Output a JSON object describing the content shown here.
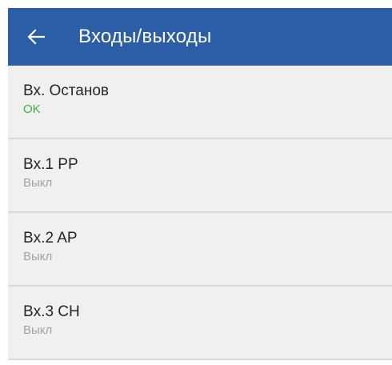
{
  "colors": {
    "appbar": "#2b5ea7",
    "ok": "#3fae49",
    "off": "#9e9e9e"
  },
  "header": {
    "back_icon": "arrow-left-icon",
    "title": "Входы/выходы"
  },
  "items": [
    {
      "label": "Вх. Останов",
      "status": "OK",
      "status_color": "#3fae49"
    },
    {
      "label": "Bx.1 PP",
      "status": "Выкл",
      "status_color": "#a3a3a3"
    },
    {
      "label": "Bx.2 AP",
      "status": "Выкл",
      "status_color": "#a3a3a3"
    },
    {
      "label": "Bx.3 CH",
      "status": "Выкл",
      "status_color": "#a3a3a3"
    }
  ]
}
